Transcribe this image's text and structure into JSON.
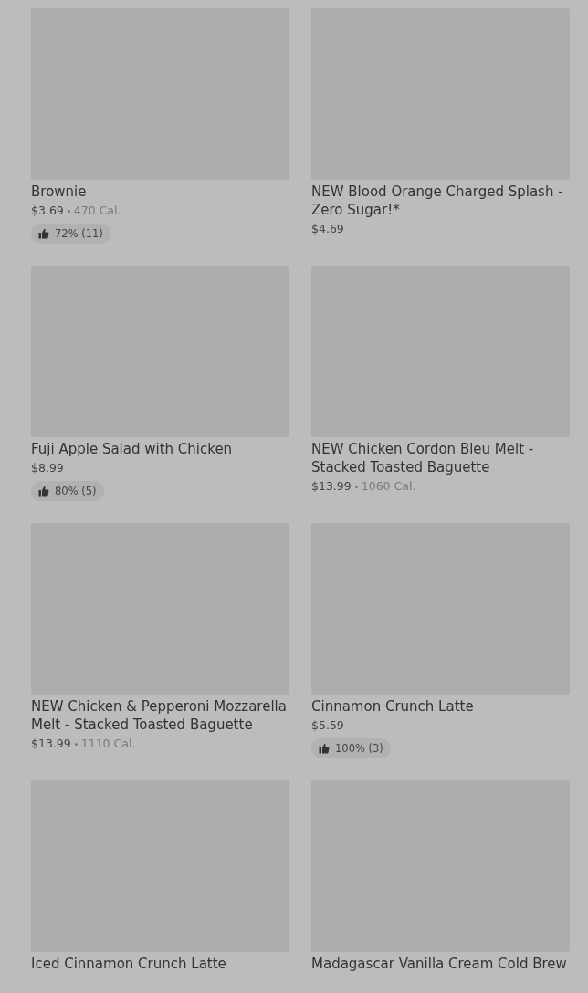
{
  "items": [
    {
      "name": "Brownie",
      "price": "$3.69",
      "calories": "470 Cal.",
      "rating": "72% (11)"
    },
    {
      "name": "NEW Blood Orange Charged Splash - Zero Sugar!*",
      "price": "$4.69"
    },
    {
      "name": "Fuji Apple Salad with Chicken",
      "price": "$8.99",
      "rating": "80% (5)"
    },
    {
      "name": "NEW Chicken Cordon Bleu Melt - Stacked Toasted Baguette",
      "price": "$13.99",
      "calories": "1060 Cal."
    },
    {
      "name": "NEW Chicken & Pepperoni Mozzarella Melt - Stacked Toasted Baguette",
      "price": "$13.99",
      "calories": "1110 Cal."
    },
    {
      "name": "Cinnamon Crunch Latte",
      "price": "$5.59",
      "rating": "100% (3)"
    },
    {
      "name": "Iced Cinnamon Crunch Latte"
    },
    {
      "name": "Madagascar Vanilla Cream Cold Brew"
    }
  ]
}
